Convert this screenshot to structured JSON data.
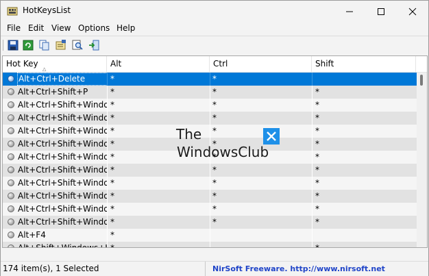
{
  "window": {
    "title": "HotKeysList",
    "minimize_icon": "minimize-icon",
    "maximize_icon": "maximize-icon",
    "close_icon": "close-icon"
  },
  "menu": [
    "File",
    "Edit",
    "View",
    "Options",
    "Help"
  ],
  "toolbar": {
    "buttons": [
      "save-icon",
      "refresh-icon",
      "copy-icon",
      "properties-icon",
      "find-icon",
      "exit-icon"
    ]
  },
  "list": {
    "columns": [
      "Hot Key",
      "Alt",
      "Ctrl",
      "Shift"
    ],
    "sort_indicator": "^",
    "rows": [
      {
        "key": "Alt+Ctrl+Delete",
        "alt": "*",
        "ctrl": "*",
        "shift": "",
        "selected": true
      },
      {
        "key": "Alt+Ctrl+Shift+P",
        "alt": "*",
        "ctrl": "*",
        "shift": "*"
      },
      {
        "key": "Alt+Ctrl+Shift+Windo...",
        "alt": "*",
        "ctrl": "*",
        "shift": "*"
      },
      {
        "key": "Alt+Ctrl+Shift+Windo...",
        "alt": "*",
        "ctrl": "*",
        "shift": "*"
      },
      {
        "key": "Alt+Ctrl+Shift+Windo...",
        "alt": "*",
        "ctrl": "*",
        "shift": "*"
      },
      {
        "key": "Alt+Ctrl+Shift+Windo...",
        "alt": "*",
        "ctrl": "*",
        "shift": "*"
      },
      {
        "key": "Alt+Ctrl+Shift+Windo...",
        "alt": "*",
        "ctrl": "*",
        "shift": "*"
      },
      {
        "key": "Alt+Ctrl+Shift+Windo...",
        "alt": "*",
        "ctrl": "*",
        "shift": "*"
      },
      {
        "key": "Alt+Ctrl+Shift+Windo...",
        "alt": "*",
        "ctrl": "*",
        "shift": "*"
      },
      {
        "key": "Alt+Ctrl+Shift+Windo...",
        "alt": "*",
        "ctrl": "*",
        "shift": "*"
      },
      {
        "key": "Alt+Ctrl+Shift+Windo...",
        "alt": "*",
        "ctrl": "*",
        "shift": "*"
      },
      {
        "key": "Alt+Ctrl+Shift+Windo...",
        "alt": "*",
        "ctrl": "*",
        "shift": "*"
      },
      {
        "key": "Alt+F4",
        "alt": "*",
        "ctrl": "",
        "shift": ""
      },
      {
        "key": "Alt+Shift+Windows+K",
        "alt": "*",
        "ctrl": "",
        "shift": "*"
      }
    ]
  },
  "watermark": {
    "line1": "The",
    "line2": "WindowsClub"
  },
  "status": {
    "count": "174 item(s), 1 Selected",
    "credit": "NirSoft Freeware.  http://www.nirsoft.net"
  },
  "colors": {
    "selection": "#0078d7",
    "credit_text": "#1f44c8"
  }
}
